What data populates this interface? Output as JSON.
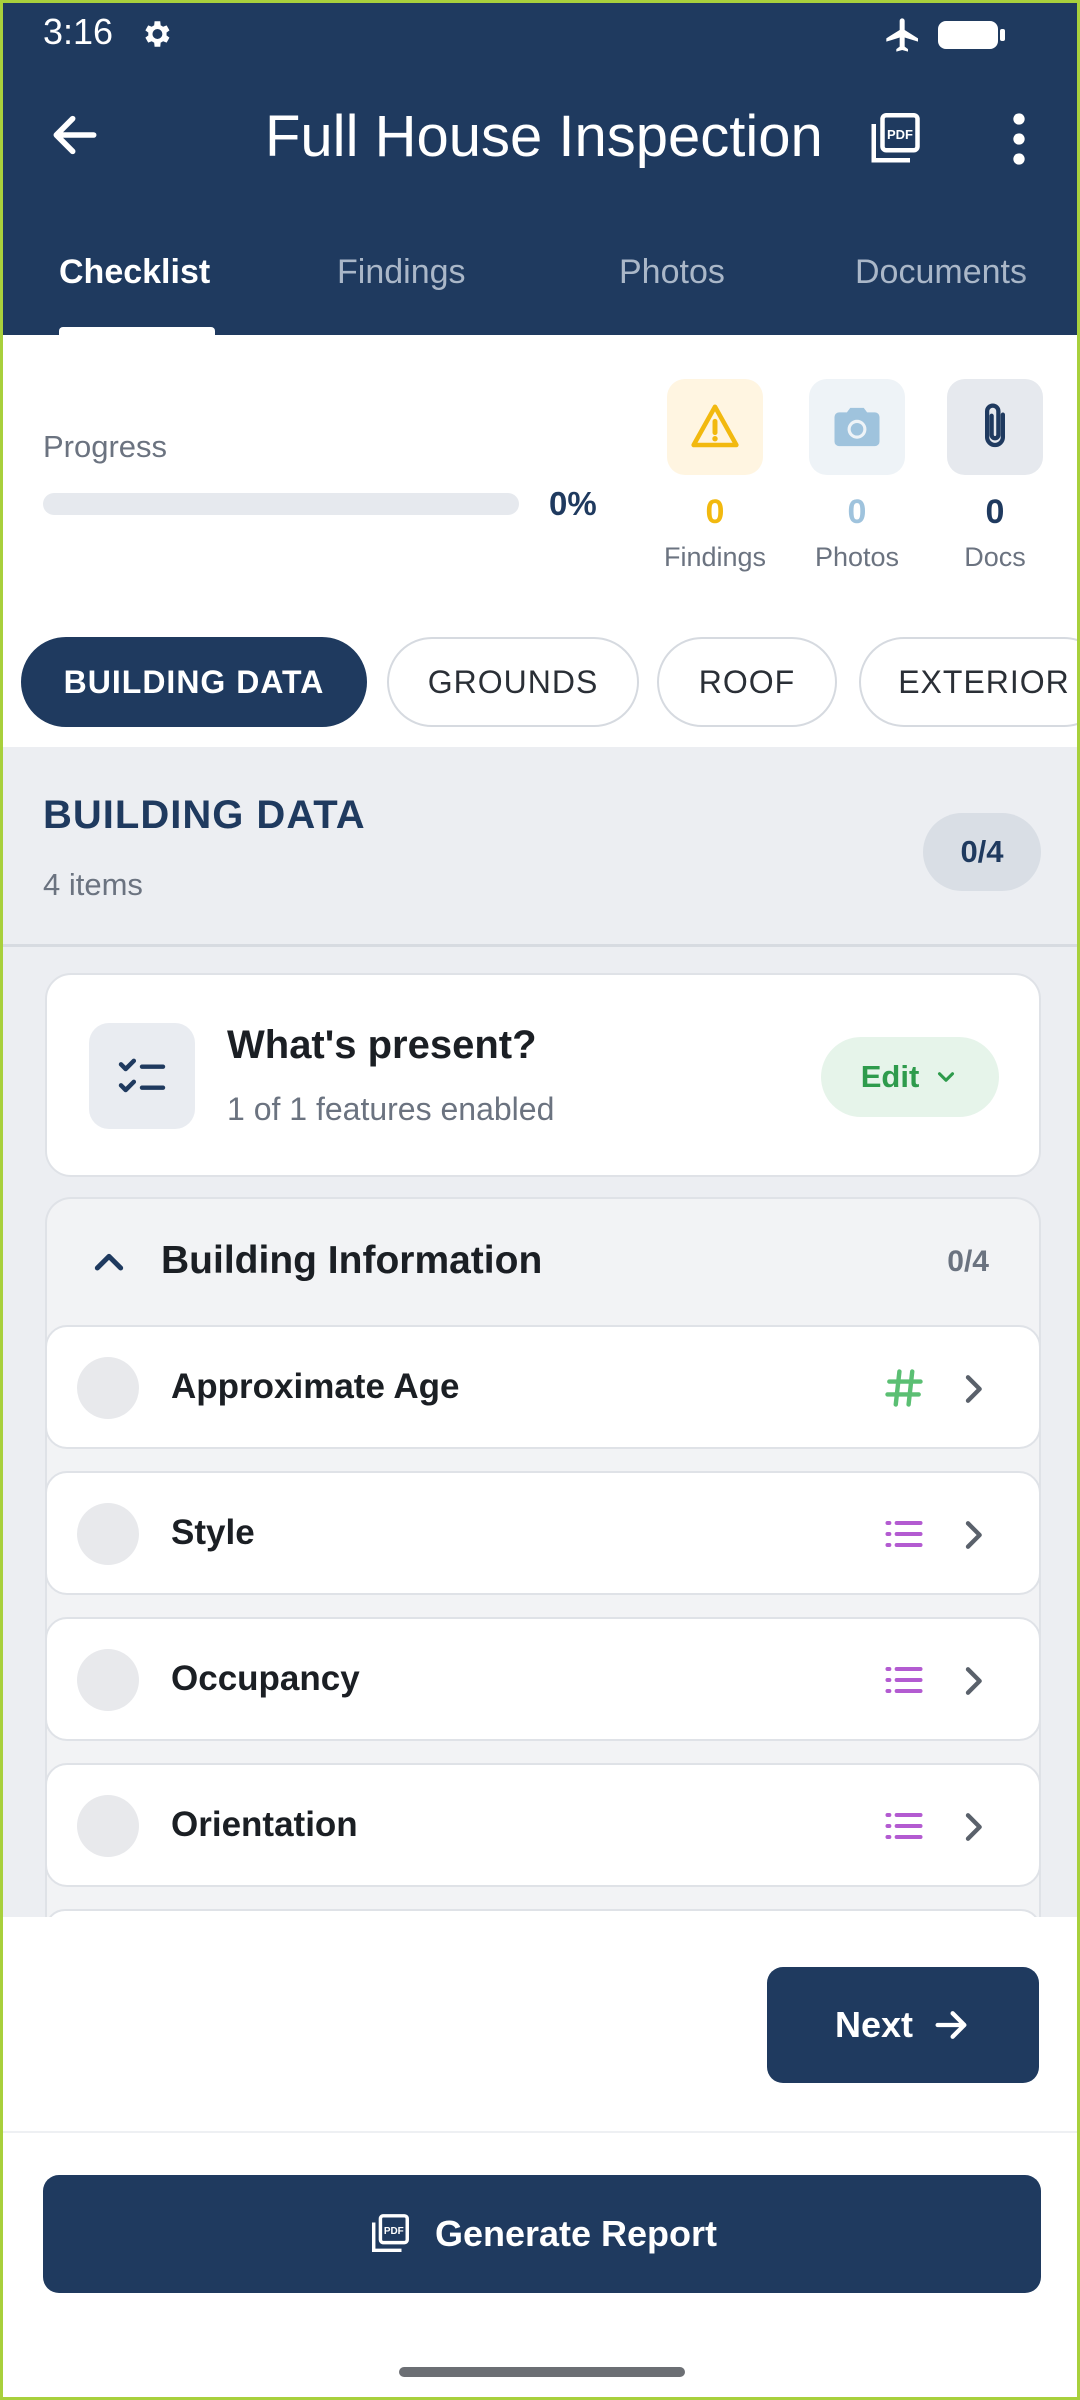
{
  "status_bar": {
    "time": "3:16"
  },
  "app_bar": {
    "title": "Full House Inspection"
  },
  "tabs": [
    {
      "label": "Checklist",
      "active": true
    },
    {
      "label": "Findings",
      "active": false
    },
    {
      "label": "Photos",
      "active": false
    },
    {
      "label": "Documents",
      "active": false
    }
  ],
  "progress": {
    "label": "Progress",
    "value": 0,
    "value_text": "0%"
  },
  "stats": [
    {
      "count": "0",
      "label": "Findings",
      "icon": "warning-icon",
      "color": "#f2b90f",
      "bg": "#fff5e1"
    },
    {
      "count": "0",
      "label": "Photos",
      "icon": "camera-icon",
      "color": "#9fc3dd",
      "bg": "#eef3f7"
    },
    {
      "count": "0",
      "label": "Docs",
      "icon": "paperclip-icon",
      "color": "#1f3a5f",
      "bg": "#e6e9ee"
    }
  ],
  "chips": [
    {
      "label": "BUILDING DATA",
      "active": true
    },
    {
      "label": "GROUNDS",
      "active": false
    },
    {
      "label": "ROOF",
      "active": false
    },
    {
      "label": "EXTERIOR",
      "active": false
    }
  ],
  "section": {
    "title": "BUILDING DATA",
    "subtitle": "4 items",
    "badge": "0/4"
  },
  "present_card": {
    "title": "What's present?",
    "subtitle": "1 of 1 features enabled",
    "edit_label": "Edit"
  },
  "group": {
    "title": "Building Information",
    "count": "0/4",
    "items": [
      {
        "label": "Approximate Age",
        "type_icon": "number-icon"
      },
      {
        "label": "Style",
        "type_icon": "list-icon"
      },
      {
        "label": "Occupancy",
        "type_icon": "list-icon"
      },
      {
        "label": "Orientation",
        "type_icon": "list-icon"
      }
    ]
  },
  "next_label": "Next",
  "generate_label": "Generate Report",
  "colors": {
    "primary": "#1f3a5f",
    "accent_green": "#2e9b4c",
    "list_icon": "#b35bd1",
    "number_icon": "#5bbf73"
  }
}
